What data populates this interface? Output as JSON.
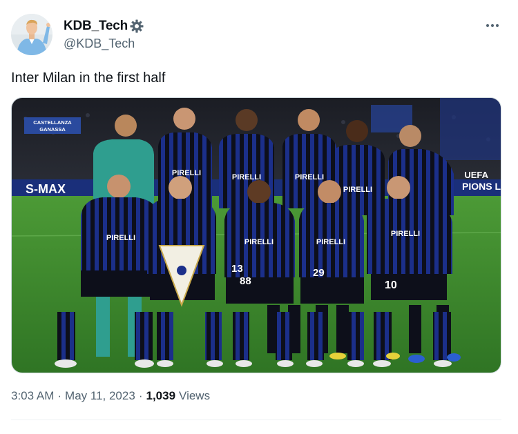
{
  "author": {
    "display_name": "KDB_Tech",
    "handle": "@KDB_Tech",
    "badge_icon": "gear-icon",
    "avatar_icon": "profile-photo"
  },
  "tweet": {
    "text": "Inter Milan in the first half",
    "media": {
      "banner_left": "S-MAX",
      "banner_top": "CASTELLANZA GANASSA",
      "banner_right_top": "UEFA",
      "banner_right_bottom": "PIONS L",
      "shirt_sponsor": "PIRELLI",
      "player_numbers": [
        "13",
        "88",
        "29",
        "10"
      ]
    }
  },
  "meta": {
    "time": "3:03 AM",
    "separator": "·",
    "date": "May 11, 2023",
    "views_count": "1,039",
    "views_label": "Views"
  },
  "colors": {
    "text_primary": "#0f1419",
    "text_secondary": "#536471",
    "kit_blue": "#1b2f8a",
    "kit_black": "#0d0f1a",
    "pitch": "#3f8a2e",
    "keeper_kit": "#2f9e8f"
  }
}
